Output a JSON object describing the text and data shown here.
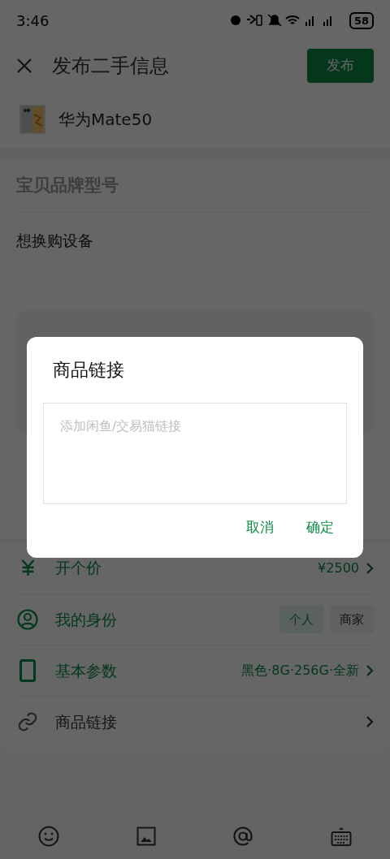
{
  "status_bar": {
    "time": "3:46",
    "battery": "58"
  },
  "header": {
    "title": "发布二手信息",
    "publish_button": "发布"
  },
  "product": {
    "name": "华为Mate50"
  },
  "form": {
    "title_placeholder": "宝贝品牌型号",
    "description": "想换购设备"
  },
  "options": [
    {
      "kind": "price",
      "label": "开个价",
      "value": "¥2500"
    },
    {
      "kind": "identity",
      "label": "我的身份",
      "choices": [
        {
          "label": "个人",
          "selected": true
        },
        {
          "label": "商家",
          "selected": false
        }
      ]
    },
    {
      "kind": "params",
      "label": "基本参数",
      "value": "黑色·8G·256G·全新"
    },
    {
      "kind": "link",
      "label": "商品链接"
    }
  ],
  "dialog": {
    "title": "商品链接",
    "placeholder": "添加闲鱼/交易猫链接",
    "buttons": [
      "取消",
      "确定"
    ]
  }
}
